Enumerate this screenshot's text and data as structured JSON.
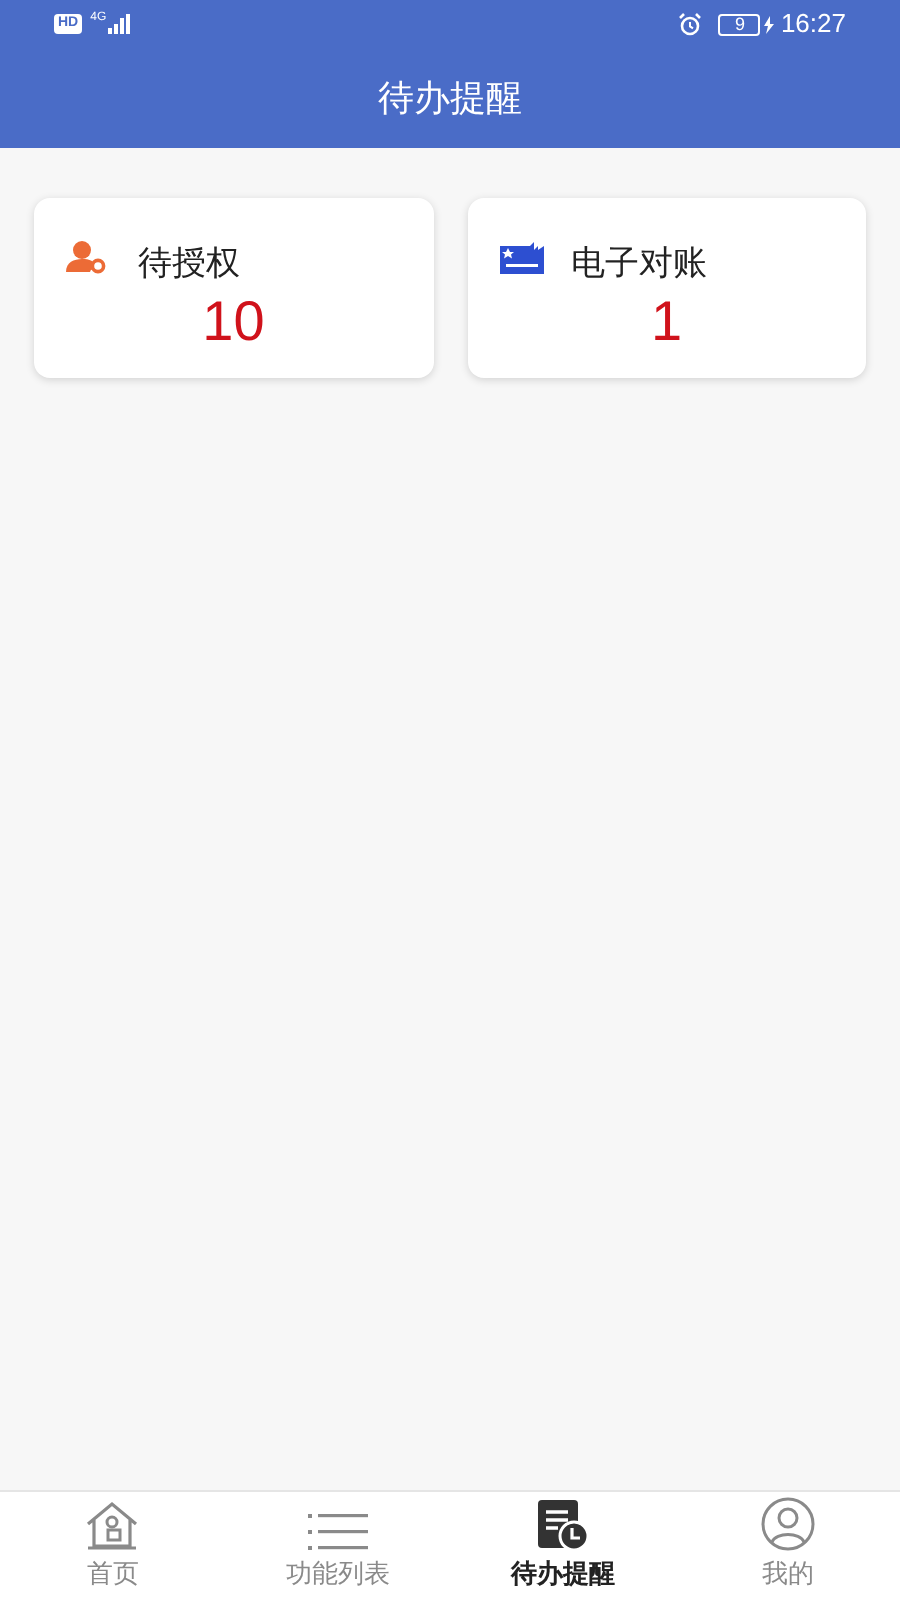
{
  "status_bar": {
    "network_badge": "HD",
    "network_type": "4G",
    "battery": "9",
    "time": "16:27"
  },
  "header": {
    "title": "待办提醒"
  },
  "cards": [
    {
      "kind": "authorize",
      "label": "待授权",
      "count": "10"
    },
    {
      "kind": "statement",
      "label": "电子对账",
      "count": "1"
    }
  ],
  "tabs": [
    {
      "kind": "home",
      "label": "首页",
      "selected": false
    },
    {
      "kind": "list",
      "label": "功能列表",
      "selected": false
    },
    {
      "kind": "todo",
      "label": "待办提醒",
      "selected": true
    },
    {
      "kind": "profile",
      "label": "我的",
      "selected": false
    }
  ]
}
